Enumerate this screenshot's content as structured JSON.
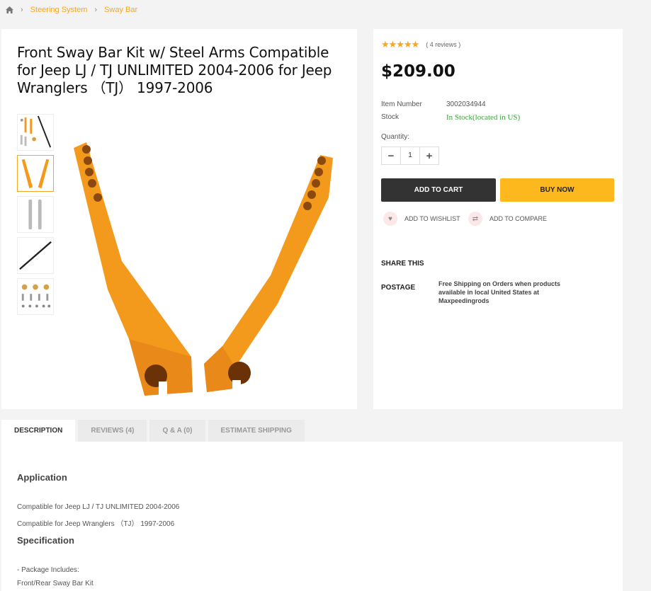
{
  "breadcrumb": {
    "items": [
      "Steering System",
      "Sway Bar"
    ]
  },
  "product": {
    "title": "Front Sway Bar Kit w/ Steel Arms Compatible for Jeep LJ / TJ UNLIMITED 2004-2006 for Jeep Wranglers （TJ） 1997-2006",
    "stars": "★★★★★",
    "reviews": "( 4 reviews )",
    "price": "$209.00",
    "item_number_label": "Item Number",
    "item_number": "3002034944",
    "stock_label": "Stock",
    "stock": "In Stock(located in US)",
    "quantity_label": "Quantity:",
    "quantity": "1",
    "add_to_cart": "ADD TO CART",
    "buy_now": "BUY NOW",
    "wishlist": "ADD TO WISHLIST",
    "compare": "ADD TO COMPARE",
    "share": "SHARE THIS",
    "postage_label": "POSTAGE",
    "postage_text": "Free Shipping on Orders when products available in local United States at Maxpeedingrods"
  },
  "tabs": [
    "DESCRIPTION",
    "REVIEWS (4)",
    "Q & A (0)",
    "ESTIMATE SHIPPING"
  ],
  "description": {
    "application_heading": "Application",
    "application_lines": [
      "Compatible for Jeep LJ / TJ UNLIMITED 2004-2006",
      "Compatible for Jeep Wranglers （TJ） 1997-2006"
    ],
    "specification_heading": "Specification",
    "spec_lines": [
      "- Package Includes:",
      "Front/Rear Sway Bar Kit"
    ]
  },
  "colors": {
    "accent": "#f5a623",
    "buy_now": "#fdb81e",
    "add_cart": "#333333",
    "in_stock": "#3aa33a",
    "arm_orange": "#f39a1c"
  }
}
